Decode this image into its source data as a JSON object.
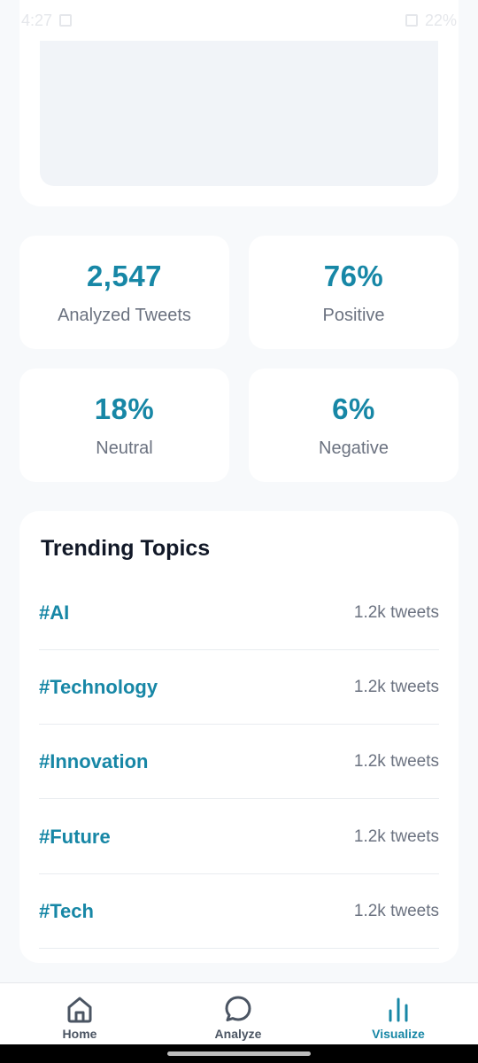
{
  "status_bar": {
    "time": "4:27",
    "battery": "22%"
  },
  "stats": [
    {
      "value": "2,547",
      "label": "Analyzed Tweets"
    },
    {
      "value": "76%",
      "label": "Positive"
    },
    {
      "value": "18%",
      "label": "Neutral"
    },
    {
      "value": "6%",
      "label": "Negative"
    }
  ],
  "trending": {
    "title": "Trending Topics",
    "topics": [
      {
        "tag": "#AI",
        "count": "1.2k tweets"
      },
      {
        "tag": "#Technology",
        "count": "1.2k tweets"
      },
      {
        "tag": "#Innovation",
        "count": "1.2k tweets"
      },
      {
        "tag": "#Future",
        "count": "1.2k tweets"
      },
      {
        "tag": "#Tech",
        "count": "1.2k tweets"
      }
    ]
  },
  "nav": {
    "items": [
      {
        "label": "Home",
        "icon": "home-icon",
        "active": false
      },
      {
        "label": "Analyze",
        "icon": "chat-bubble-icon",
        "active": false
      },
      {
        "label": "Visualize",
        "icon": "bar-chart-icon",
        "active": true
      }
    ]
  },
  "colors": {
    "accent": "#1787a6",
    "background": "#f7f9fb",
    "card": "#ffffff",
    "muted_text": "#6b7280"
  }
}
